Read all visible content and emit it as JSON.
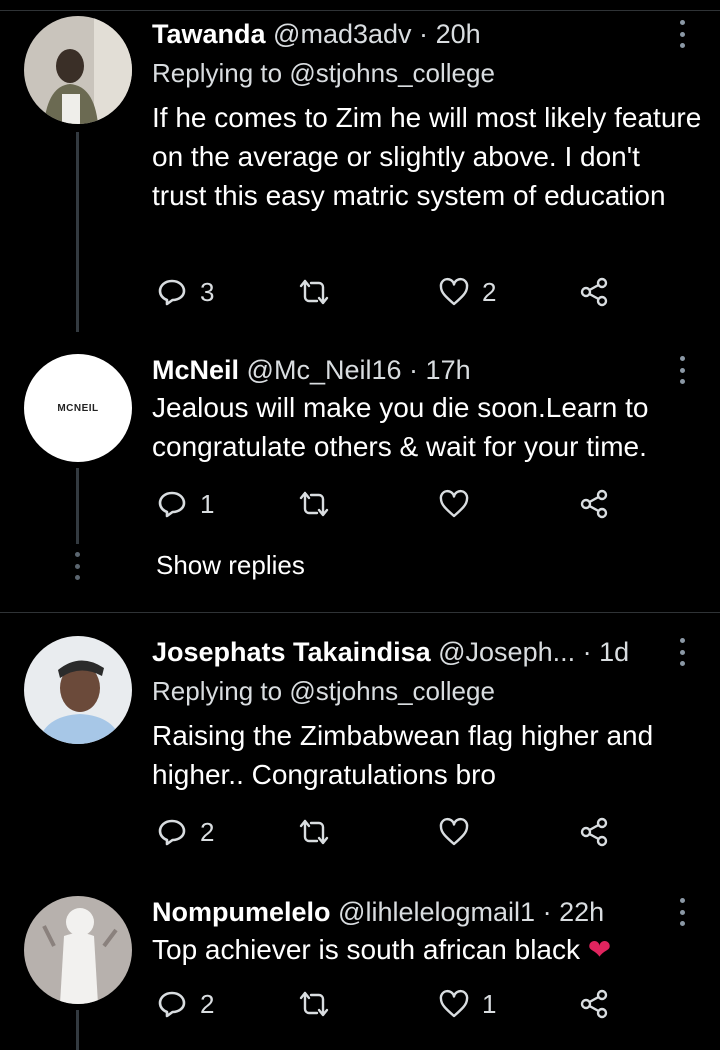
{
  "tweets": [
    {
      "name": "Tawanda",
      "handle": "@mad3adv",
      "dot": "·",
      "time": "20h",
      "replying_label": "Replying to",
      "replying_to": "@stjohns_college",
      "text": "If he comes to Zim he will most likely feature on the average or slightly above. I don't trust this easy matric system of education",
      "reply_count": "3",
      "retweet_count": "",
      "like_count": "2",
      "avatar_colors": [
        "#c9c4bc",
        "#6b6a52",
        "#efeeea"
      ]
    },
    {
      "name": "McNeil",
      "handle": "@Mc_Neil16",
      "dot": "·",
      "time": "17h",
      "text": "Jealous will make you die soon.Learn to congratulate others & wait for your time.",
      "reply_count": "1",
      "retweet_count": "",
      "like_count": "",
      "avatar_logo": "MCNEIL"
    },
    {
      "name": "Josephats Takaindisa",
      "handle": "@Joseph...",
      "dot": "·",
      "time": "1d",
      "replying_label": "Replying to",
      "replying_to": "@stjohns_college",
      "text": "Raising the Zimbabwean flag higher and higher.. Congratulations bro",
      "reply_count": "2",
      "retweet_count": "",
      "like_count": "",
      "avatar_colors": [
        "#e9ecef",
        "#6b4a3a",
        "#a7c7e7"
      ]
    },
    {
      "name": "Nompumelelo",
      "handle": "@lihlelelogmail1",
      "dot": "·",
      "time": "22h",
      "text": "Top achiever is south african black",
      "emoji": "❤",
      "reply_count": "2",
      "retweet_count": "",
      "like_count": "1",
      "avatar_colors": [
        "#b7b1ad",
        "#f2f1ef",
        "#8a817d"
      ]
    }
  ],
  "show_replies_label": "Show replies",
  "colors": {
    "background": "#000000",
    "secondary_text": "#d9dde0",
    "divider": "#2f3336",
    "thread_line": "#333a40",
    "heart_emoji": "#e0245e"
  },
  "icons": [
    "reply-icon",
    "retweet-icon",
    "like-icon",
    "share-icon",
    "more-icon"
  ]
}
